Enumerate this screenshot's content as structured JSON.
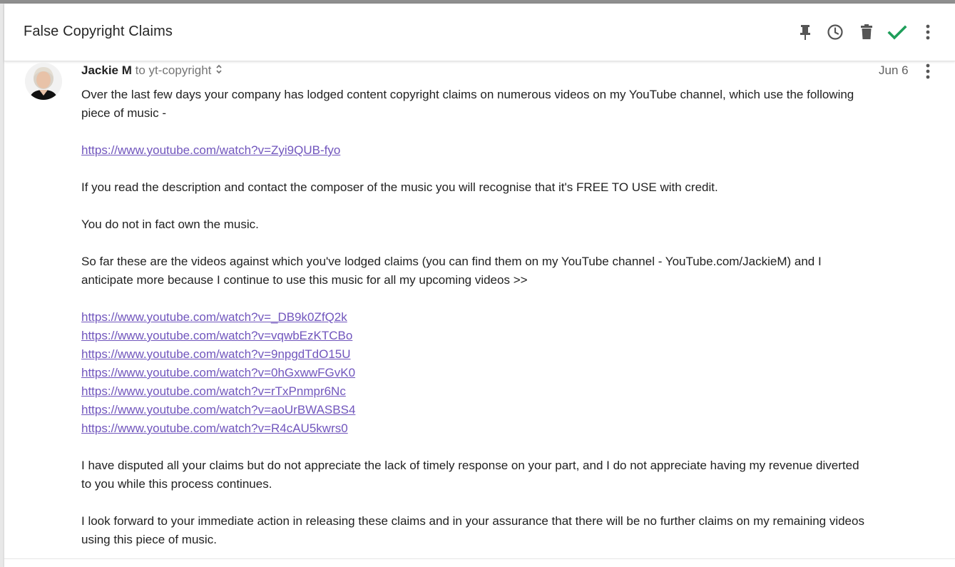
{
  "thread": {
    "subject": "False Copyright Claims",
    "actions": [
      "pin-icon",
      "snooze-clock-icon",
      "trash-icon",
      "done-check-icon",
      "more-vert-icon"
    ],
    "accent": "#1e9e5a"
  },
  "message": {
    "sender": "Jackie M",
    "recipient": "to yt-copyright",
    "date": "Jun 6",
    "paragraphs": {
      "p1": "Over the last few days your company has lodged content copyright claims on numerous videos on my YouTube channel, which use the following piece of music -",
      "p2": "If you read the description and contact the composer of the music you will recognise that it's FREE TO USE with credit.",
      "p3": "You do not in fact own the music.",
      "p4": "So far these are the videos against which you've lodged claims (you can find them on my YouTube channel - YouTube.com/JackieM) and I anticipate more because I continue to use this music for all my upcoming videos >>",
      "p5": "I have disputed all your claims but do not appreciate the lack of timely response on your part, and I do not appreciate having my revenue diverted to you while this process continues.",
      "p6": "I look forward to your immediate action in releasing these claims and in your assurance that there will be no further claims on my remaining videos using this piece of music."
    },
    "music_link": "https://www.youtube.com/watch?v=Zyi9QUB-fyo",
    "video_links": [
      "https://www.youtube.com/watch?v=_DB9k0ZfQ2k",
      "https://www.youtube.com/watch?v=vqwbEzKTCBo",
      "https://www.youtube.com/watch?v=9npgdTdO15U",
      "https://www.youtube.com/watch?v=0hGxwwFGvK0",
      "https://www.youtube.com/watch?v=rTxPnmpr6Nc",
      "https://www.youtube.com/watch?v=aoUrBWASBS4",
      "https://www.youtube.com/watch?v=R4cAU5kwrs0"
    ],
    "link_color": "#7156bd"
  }
}
